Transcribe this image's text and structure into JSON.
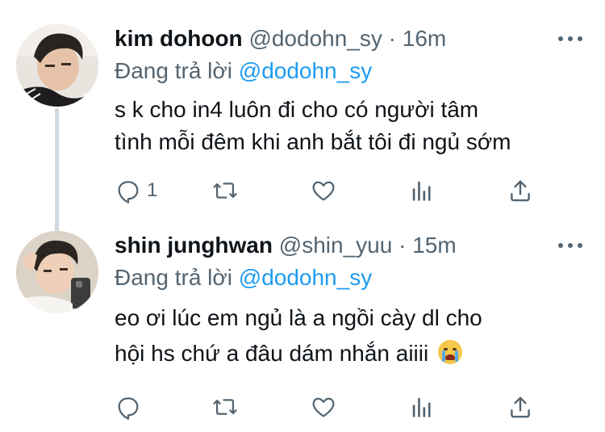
{
  "tweets": [
    {
      "name": "kim dohoon",
      "handle": "@dodohn_sy",
      "dot": "·",
      "time": "16m",
      "replying_prefix": "Đang trả lời",
      "replying_to": "@dodohn_sy",
      "text_lines": [
        "s k cho in4 luôn đi cho có người tâm",
        "tình mỗi đêm khi anh bắt tôi đi ngủ sớm"
      ],
      "reply_count": "1",
      "retweet_count": "",
      "like_count": ""
    },
    {
      "name": "shin junghwan",
      "handle": "@shin_yuu",
      "dot": "·",
      "time": "15m",
      "replying_prefix": "Đang trả lời",
      "replying_to": "@dodohn_sy",
      "text_lines": [
        "eo ơi lúc em ngủ là a ngồi cày dl cho",
        "hội hs chứ a đâu dám nhắn aiiii"
      ],
      "reply_count": "",
      "retweet_count": "",
      "like_count": ""
    }
  ],
  "colors": {
    "text": "#0f1419",
    "muted": "#536471",
    "link": "#1d9bf0",
    "line": "#cfd9de"
  },
  "icons": [
    "reply-icon",
    "retweet-icon",
    "like-icon",
    "analytics-icon",
    "share-icon",
    "more-icon",
    "loudly-crying-face-emoji"
  ]
}
